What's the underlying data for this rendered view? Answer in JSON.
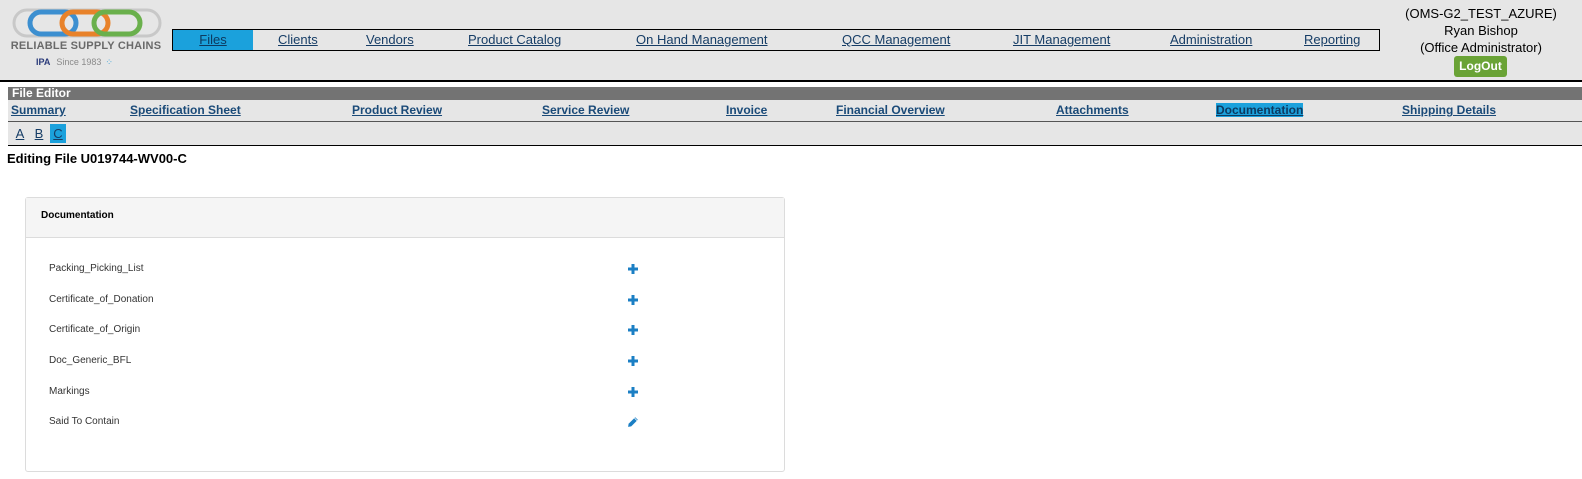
{
  "logo": {
    "name": "RELIABLE SUPPLY CHAINS",
    "partner": "IPA",
    "since": "Since 1983"
  },
  "nav": [
    {
      "label": "Files",
      "active": true
    },
    {
      "label": "Clients"
    },
    {
      "label": "Vendors"
    },
    {
      "label": "Product Catalog"
    },
    {
      "label": "On Hand Management"
    },
    {
      "label": "QCC Management"
    },
    {
      "label": "JIT Management"
    },
    {
      "label": "Administration"
    },
    {
      "label": "Reporting"
    }
  ],
  "user": {
    "env": "(OMS-G2_TEST_AZURE)",
    "name": "Ryan Bishop",
    "role": "(Office Administrator)",
    "logout": "LogOut"
  },
  "editor": {
    "title": "File Editor",
    "editing": "Editing File U019744-WV00-C"
  },
  "subnav": [
    {
      "label": "Summary"
    },
    {
      "label": "Specification Sheet"
    },
    {
      "label": "Product Review"
    },
    {
      "label": "Service Review"
    },
    {
      "label": "Invoice"
    },
    {
      "label": "Financial Overview"
    },
    {
      "label": "Attachments"
    },
    {
      "label": "Documentation",
      "active": true
    },
    {
      "label": "Shipping Details"
    }
  ],
  "variants": [
    {
      "label": "A"
    },
    {
      "label": "B"
    },
    {
      "label": "C",
      "active": true
    }
  ],
  "panel": {
    "title": "Documentation",
    "rows": [
      {
        "label": "Packing_Picking_List",
        "action": "plus-icon"
      },
      {
        "label": "Certificate_of_Donation",
        "action": "plus-icon"
      },
      {
        "label": "Certificate_of_Origin",
        "action": "plus-icon"
      },
      {
        "label": "Doc_Generic_BFL",
        "action": "plus-icon"
      },
      {
        "label": "Markings",
        "action": "plus-icon"
      },
      {
        "label": "Said To Contain",
        "action": "pencil-icon"
      }
    ]
  },
  "colors": {
    "accent": "#1ba1dc",
    "link": "#163d66",
    "logout": "#6aa336",
    "plus": "#1b7fc4"
  }
}
